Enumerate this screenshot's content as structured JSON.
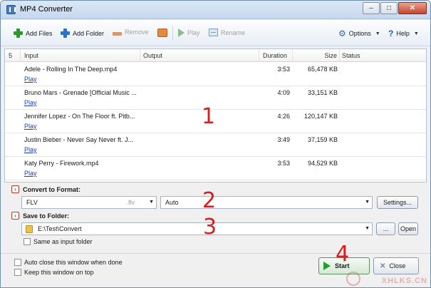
{
  "window": {
    "title": "MP4 Converter",
    "minimize": "–",
    "maximize": "□",
    "close": "✕"
  },
  "toolbar": {
    "add_files": "Add Files",
    "add_folder": "Add Folder",
    "remove": "Remove",
    "play": "Play",
    "rename": "Rename",
    "options": "Options",
    "help": "Help"
  },
  "list": {
    "columns": {
      "count": "5",
      "input": "Input",
      "output": "Output",
      "duration": "Duration",
      "size": "Size",
      "status": "Status"
    },
    "rows": [
      {
        "name": "Adele - Rolling In The Deep.mp4",
        "action": "Play",
        "duration": "3:53",
        "size": "65,478 KB"
      },
      {
        "name": "Bruno Mars - Grenade [Official Music ...",
        "action": "Play",
        "duration": "4:09",
        "size": "33,151 KB"
      },
      {
        "name": "Jennifer Lopez - On The Floor ft. Pitb...",
        "action": "Play",
        "duration": "4:26",
        "size": "120,147 KB"
      },
      {
        "name": "Justin Bieber - Never Say Never ft. J...",
        "action": "Play",
        "duration": "3:49",
        "size": "37,159 KB"
      },
      {
        "name": "Katy Perry - Firework.mp4",
        "action": "Play",
        "duration": "3:53",
        "size": "94,529 KB"
      }
    ]
  },
  "convert": {
    "label": "Convert to Format:",
    "format": "FLV",
    "format_ext": ".flv",
    "preset": "Auto",
    "settings": "Settings..."
  },
  "save": {
    "label": "Save to Folder:",
    "path": "E:\\Test\\Convert",
    "browse": "...",
    "open": "Open",
    "same_as_input": "Same as input folder"
  },
  "bottom": {
    "auto_close": "Auto close this window when done",
    "keep_on_top": "Keep this window on top",
    "start": "Start",
    "close": "Close"
  },
  "annotations": {
    "one": "1",
    "two": "2",
    "three": "3",
    "four": "4"
  },
  "watermark": "XHLKS.CN"
}
